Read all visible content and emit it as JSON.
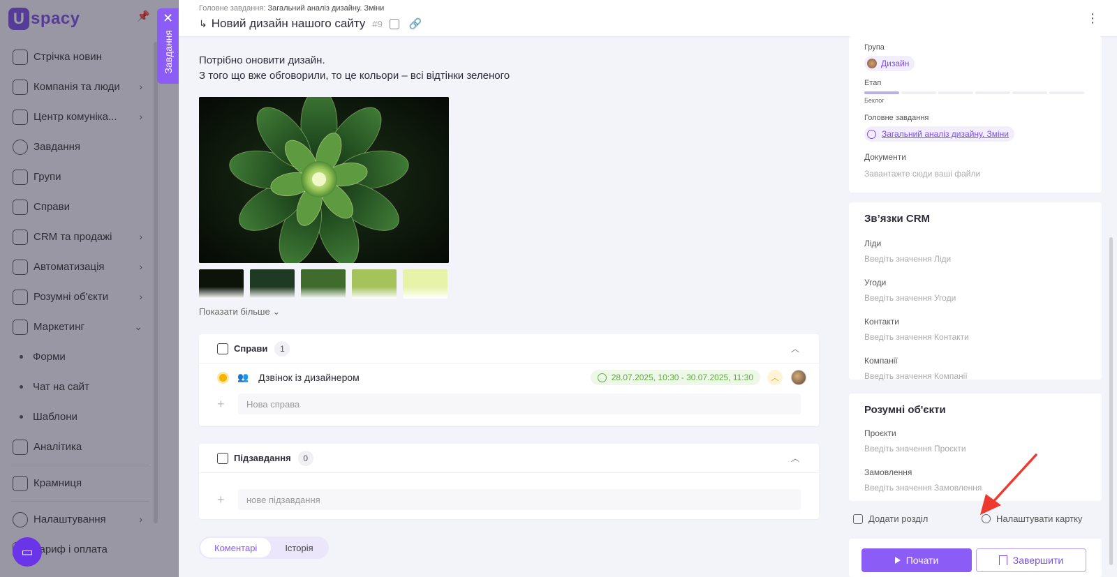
{
  "brand": {
    "logo_letter": "U",
    "logo_text": "spacy",
    "accent": "#8b5cf6"
  },
  "sidebar": {
    "items": [
      {
        "label": "Стрічка новин",
        "icon": "home-icon"
      },
      {
        "label": "Компанія та люди",
        "icon": "company-icon"
      },
      {
        "label": "Центр комуніка...",
        "icon": "chat-icon"
      },
      {
        "label": "Завдання",
        "icon": "check-icon"
      },
      {
        "label": "Групи",
        "icon": "users-icon"
      },
      {
        "label": "Справи",
        "icon": "calendar-icon"
      },
      {
        "label": "CRM та продажі",
        "icon": "database-icon"
      },
      {
        "label": "Автоматизація",
        "icon": "bolt-icon"
      },
      {
        "label": "Розумні об'єкти",
        "icon": "code-icon"
      },
      {
        "label": "Маркетинг",
        "icon": "megaphone-icon"
      }
    ],
    "sub_items": [
      "Форми",
      "Чат на сайт",
      "Шаблони"
    ],
    "bottom_items": [
      {
        "label": "Аналітика",
        "icon": "chart-icon"
      },
      {
        "label": "Крамниця",
        "icon": "store-icon"
      },
      {
        "label": "Налаштування",
        "icon": "gear-icon"
      },
      {
        "label": "Тариф і оплата",
        "icon": "card-icon"
      }
    ]
  },
  "side_tab": {
    "label": "Завдання",
    "close": "✕"
  },
  "header": {
    "breadcrumb_label": "Головне завдання:",
    "breadcrumb_value": "Загальний аналіз дизайну. Зміни",
    "title": "Новий дизайн нашого сайту",
    "number": "#9"
  },
  "description": {
    "line1": "Потрібно оновити дизайн.",
    "line2": "З того що вже обговорили, то це кольори – всі відтінки зеленого"
  },
  "swatches": [
    "#0c140a",
    "#1f3a22",
    "#3f6b2c",
    "#a6c25a",
    "#e6f3a8"
  ],
  "show_more": "Показати більше",
  "affairs": {
    "label": "Справи",
    "count": "1",
    "task": {
      "name": "Дзвінок із дизайнером",
      "date": "28.07.2025, 10:30 - 30.07.2025, 11:30"
    },
    "new_placeholder": "Нова справа"
  },
  "subtasks": {
    "label": "Підзавдання",
    "count": "0",
    "new_placeholder": "нове підзавдання"
  },
  "tabs": {
    "comments": "Коментарі",
    "history": "Історія"
  },
  "right": {
    "group_label": "Група",
    "group_value": "Дизайн",
    "stage_label": "Етап",
    "stage_value": "Беклог",
    "parent_label": "Головне завдання",
    "parent_value": "Загальний аналіз дизайну. Зміни",
    "docs_label": "Документи",
    "docs_placeholder": "Завантажте сюди ваші файли",
    "crm": {
      "title": "Зв’язки CRM",
      "fields": [
        {
          "label": "Ліди",
          "placeholder": "Введіть значення Ліди"
        },
        {
          "label": "Угоди",
          "placeholder": "Введіть значення Угоди"
        },
        {
          "label": "Контакти",
          "placeholder": "Введіть значення Контакти"
        },
        {
          "label": "Компанії",
          "placeholder": "Введіть значення Компанії"
        }
      ]
    },
    "smart": {
      "title": "Розумні об'єкти",
      "fields": [
        {
          "label": "Проєкти",
          "placeholder": "Введіть значення Проєкти"
        },
        {
          "label": "Замовлення",
          "placeholder": "Введіть значення Замовлення"
        }
      ]
    },
    "add_section": "Додати розділ",
    "configure_card": "Налаштувати картку",
    "start": "Почати",
    "finish": "Завершити"
  }
}
